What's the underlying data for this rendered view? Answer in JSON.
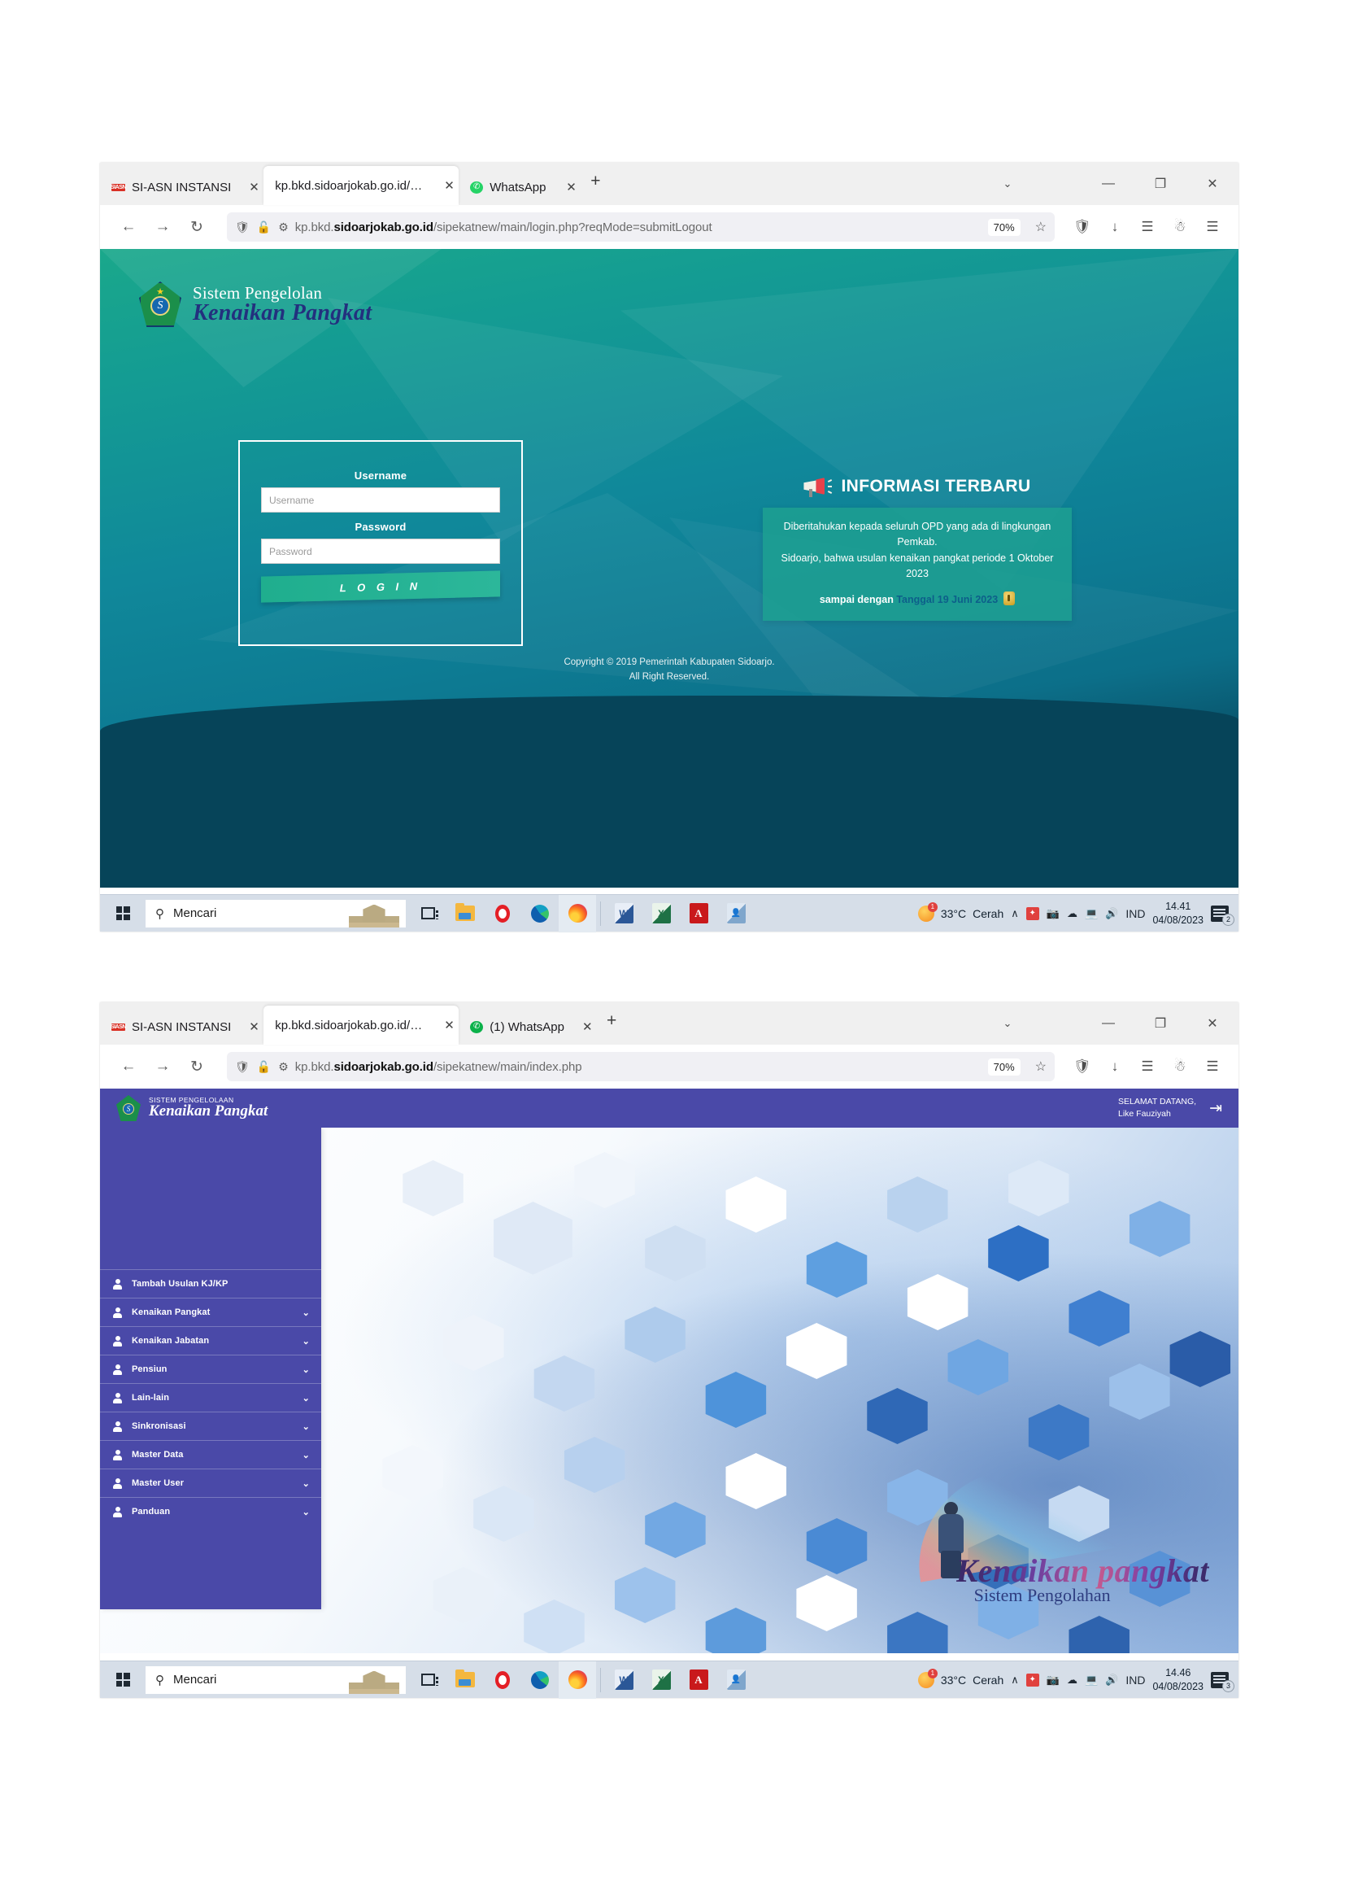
{
  "browser": {
    "tabs_login": [
      {
        "title": "SI-ASN INSTANSI",
        "favicon": "siasn-icon",
        "active": false
      },
      {
        "title": "kp.bkd.sidoarjokab.go.id/sipekatne",
        "favicon": "page-icon",
        "active": true
      },
      {
        "title": "WhatsApp",
        "favicon": "whatsapp-icon",
        "active": false
      }
    ],
    "tabs_dash": [
      {
        "title": "SI-ASN INSTANSI",
        "favicon": "siasn-icon",
        "active": false
      },
      {
        "title": "kp.bkd.sidoarjokab.go.id/sipekatne",
        "favicon": "page-icon",
        "active": true
      },
      {
        "title": "(1) WhatsApp",
        "favicon": "whatsapp-icon",
        "active": false
      }
    ],
    "new_tab_label": "+",
    "close_label": "✕",
    "window_controls": {
      "list_all_tabs": "⌄",
      "minimize": "—",
      "maximize": "❐",
      "close": "✕"
    },
    "nav": {
      "back": "←",
      "forward": "→",
      "reload": "↻"
    },
    "url_login": {
      "prefix": "kp.bkd.",
      "domain": "sidoarjokab.go.id",
      "path": "/sipekatnew/main/login.php?reqMode=submitLogout"
    },
    "url_dash": {
      "prefix": "kp.bkd.",
      "domain": "sidoarjokab.go.id",
      "path": "/sipekatnew/main/index.php"
    },
    "zoom_level": "70%",
    "bookmark_star": "☆",
    "toolbar_icons": [
      "shield-icon",
      "download-icon",
      "library-icon",
      "account-icon",
      "menu-icon"
    ]
  },
  "login_page": {
    "brand": {
      "line1": "Sistem Pengelolan",
      "line2": "Kenaikan Pangkat",
      "emblem_letter": "S"
    },
    "form": {
      "username_label": "Username",
      "username_placeholder": "Username",
      "username_value": "",
      "password_label": "Password",
      "password_placeholder": "Password",
      "password_value": "",
      "login_button": "L O G I N"
    },
    "info": {
      "title": "INFORMASI TERBARU",
      "body_line1": "Diberitahukan kepada seluruh OPD yang ada di lingkungan Pemkab.",
      "body_line2": "Sidoarjo, bahwa usulan kenaikan pangkat periode 1 Oktober 2023",
      "bottom_prefix": "sampai dengan ",
      "bottom_highlight": "Tanggal 19 Juni 2023"
    },
    "copyright_line1": "Copyright © 2019 Pemerintah Kabupaten Sidoarjo.",
    "copyright_line2": "All Right Reserved."
  },
  "dashboard_page": {
    "header": {
      "brand_small": "SISTEM PENGELOLAAN",
      "brand_large": "Kenaikan Pangkat",
      "welcome_line1": "SELAMAT DATANG,",
      "welcome_line2": "Like Fauziyah",
      "logout_icon": "logout-icon"
    },
    "sidebar": {
      "items": [
        {
          "label": "Tambah Usulan KJ/KP",
          "expandable": false
        },
        {
          "label": "Kenaikan Pangkat",
          "expandable": true
        },
        {
          "label": "Kenaikan Jabatan",
          "expandable": true
        },
        {
          "label": "Pensiun",
          "expandable": true
        },
        {
          "label": "Lain-lain",
          "expandable": true
        },
        {
          "label": "Sinkronisasi",
          "expandable": true
        },
        {
          "label": "Master Data",
          "expandable": true
        },
        {
          "label": "Master User",
          "expandable": true
        },
        {
          "label": "Panduan",
          "expandable": true
        }
      ],
      "chevron": "⌄"
    },
    "watermark": {
      "title": "Kenaikan pangkat",
      "subtitle": "Sistem Pengolahan"
    }
  },
  "taskbar_login": {
    "search_placeholder": "Mencari",
    "search_icon": "search-icon",
    "apps": [
      "task-view-icon",
      "file-explorer-icon",
      "opera-icon",
      "edge-icon",
      "firefox-icon",
      "word-icon",
      "excel-icon",
      "pdf-icon",
      "contacts-icon"
    ],
    "weather_temp": "33°C",
    "weather_desc": "Cerah",
    "weather_badge": "1",
    "language": "IND",
    "time": "14.41",
    "date": "04/08/2023",
    "notification_count": "2",
    "tray_chevron": "∧"
  },
  "taskbar_dash": {
    "search_placeholder": "Mencari",
    "search_icon": "search-icon",
    "weather_temp": "33°C",
    "weather_desc": "Cerah",
    "weather_badge": "1",
    "language": "IND",
    "time": "14.46",
    "date": "04/08/2023",
    "notification_count": "3",
    "tray_chevron": "∧"
  },
  "colors": {
    "login_gradient_top": "#1aa88b",
    "login_gradient_bottom": "#05394c",
    "login_footer": "#064459",
    "login_button": "#22b094",
    "info_card": "#1da092",
    "info_highlight": "#0d5f8a",
    "dashboard_purple": "#4a49a8",
    "taskbar": "#d6dee8"
  }
}
